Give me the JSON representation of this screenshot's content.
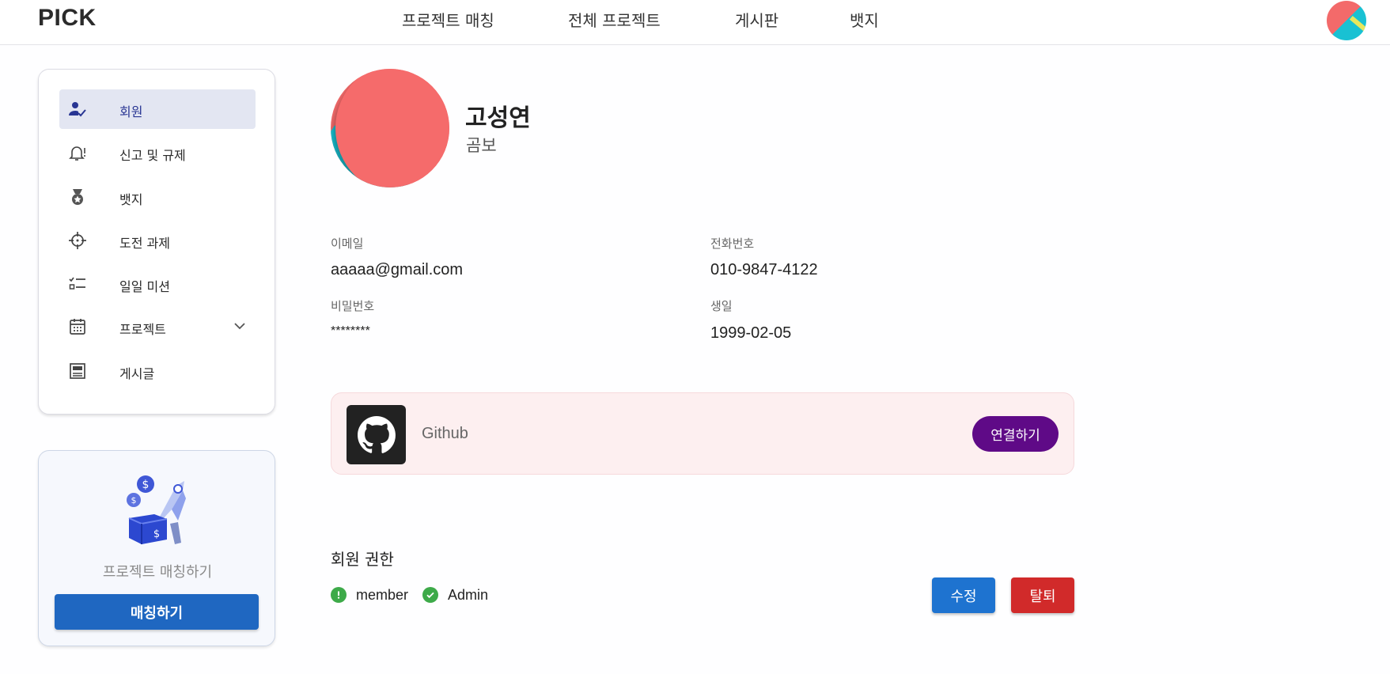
{
  "header": {
    "logo": "PICK",
    "nav": [
      "프로젝트 매칭",
      "전체 프로젝트",
      "게시판",
      "뱃지"
    ]
  },
  "sidebar": {
    "items": [
      {
        "label": "회원",
        "icon": "user-check-icon",
        "active": true
      },
      {
        "label": "신고 및 규제",
        "icon": "bell-alert-icon"
      },
      {
        "label": "뱃지",
        "icon": "medal-icon"
      },
      {
        "label": "도전 과제",
        "icon": "crosshair-icon"
      },
      {
        "label": "일일 미션",
        "icon": "checklist-icon"
      },
      {
        "label": "프로젝트",
        "icon": "calendar-icon",
        "expandable": true
      },
      {
        "label": "게시글",
        "icon": "article-icon"
      }
    ]
  },
  "promo": {
    "text": "프로젝트 매칭하기",
    "button": "매칭하기"
  },
  "profile": {
    "name": "고성연",
    "role": "곰보",
    "email_label": "이메일",
    "email": "aaaaa@gmail.com",
    "phone_label": "전화번호",
    "phone": "010-9847-4122",
    "password_label": "비밀번호",
    "password": "********",
    "birth_label": "생일",
    "birth": "1999-02-05"
  },
  "github": {
    "label": "Github",
    "connect_button": "연결하기"
  },
  "permissions": {
    "title": "회원 권한",
    "items": [
      "member",
      "Admin"
    ],
    "edit_button": "수정",
    "withdraw_button": "탈퇴"
  },
  "colors": {
    "primary": "#1f67c1",
    "active_menu_bg": "#e3e6f2",
    "connect": "#5f0a87",
    "danger": "#d12a2a",
    "success": "#3daa49"
  }
}
